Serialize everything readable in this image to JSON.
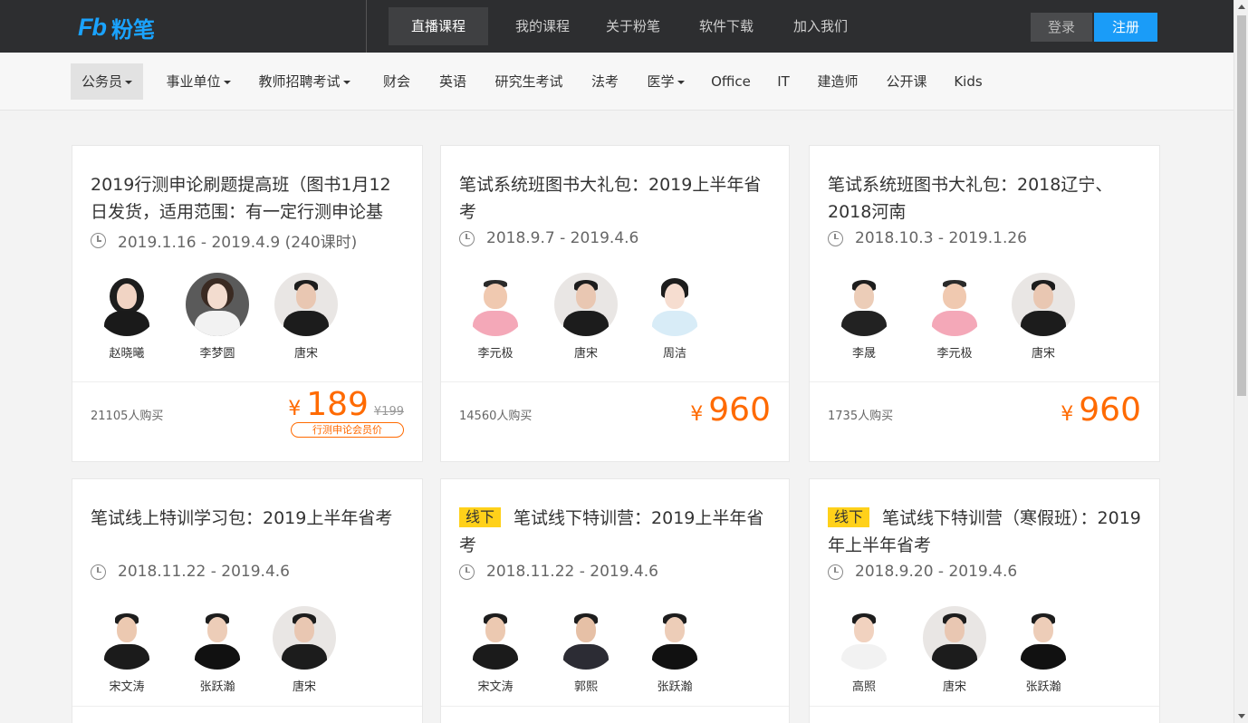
{
  "header": {
    "logo_mark": "Fb",
    "logo_text": "粉笔",
    "nav": [
      "直播课程",
      "我的课程",
      "关于粉笔",
      "软件下载",
      "加入我们"
    ],
    "login": "登录",
    "register": "注册"
  },
  "categories": [
    {
      "label": "公务员",
      "dropdown": true
    },
    {
      "label": "事业单位",
      "dropdown": true
    },
    {
      "label": "教师招聘考试",
      "dropdown": true
    },
    {
      "label": "财会",
      "dropdown": false
    },
    {
      "label": "英语",
      "dropdown": false
    },
    {
      "label": "研究生考试",
      "dropdown": false
    },
    {
      "label": "法考",
      "dropdown": false
    },
    {
      "label": "医学",
      "dropdown": true
    },
    {
      "label": "Office",
      "dropdown": false
    },
    {
      "label": "IT",
      "dropdown": false
    },
    {
      "label": "建造师",
      "dropdown": false
    },
    {
      "label": "公开课",
      "dropdown": false
    },
    {
      "label": "Kids",
      "dropdown": false
    }
  ],
  "courses": [
    {
      "tag": "",
      "title": "2019行测申论刷题提高班（图书1月12日发货，适用范围：有一定行测申论基",
      "date": "2019.1.16 - 2019.4.9 (240课时)",
      "teachers": [
        "赵晓曦",
        "李梦圆",
        "唐宋"
      ],
      "buyers_count": "21105",
      "buyers_suffix": "人购买",
      "currency": "¥",
      "price": "189",
      "original_price": "¥199",
      "member_label": "行测申论会员价"
    },
    {
      "tag": "",
      "title": "笔试系统班图书大礼包：2019上半年省考",
      "date": "2018.9.7 - 2019.4.6",
      "teachers": [
        "李元极",
        "唐宋",
        "周洁"
      ],
      "buyers_count": "14560",
      "buyers_suffix": "人购买",
      "currency": "¥",
      "price": "960",
      "original_price": "",
      "member_label": ""
    },
    {
      "tag": "",
      "title": "笔试系统班图书大礼包：2018辽宁、2018河南",
      "date": "2018.10.3 - 2019.1.26",
      "teachers": [
        "李晟",
        "李元极",
        "唐宋"
      ],
      "buyers_count": "1735",
      "buyers_suffix": "人购买",
      "currency": "¥",
      "price": "960",
      "original_price": "",
      "member_label": ""
    },
    {
      "tag": "",
      "title": "笔试线上特训学习包：2019上半年省考",
      "date": "2018.11.22 - 2019.4.6",
      "teachers": [
        "宋文涛",
        "张跃瀚",
        "唐宋"
      ]
    },
    {
      "tag": "线下",
      "title": "笔试线下特训营：2019上半年省考",
      "date": "2018.11.22 - 2019.4.6",
      "teachers": [
        "宋文涛",
        "郭熙",
        "张跃瀚"
      ]
    },
    {
      "tag": "线下",
      "title": "笔试线下特训营（寒假班）：2019年上半年省考",
      "date": "2018.9.20 - 2019.4.6",
      "teachers": [
        "高照",
        "唐宋",
        "张跃瀚"
      ]
    }
  ],
  "colors": {
    "brand": "#1aa3ff",
    "price": "#ff6a00",
    "tag": "#ffd11a",
    "topbar": "#2d2e30"
  }
}
